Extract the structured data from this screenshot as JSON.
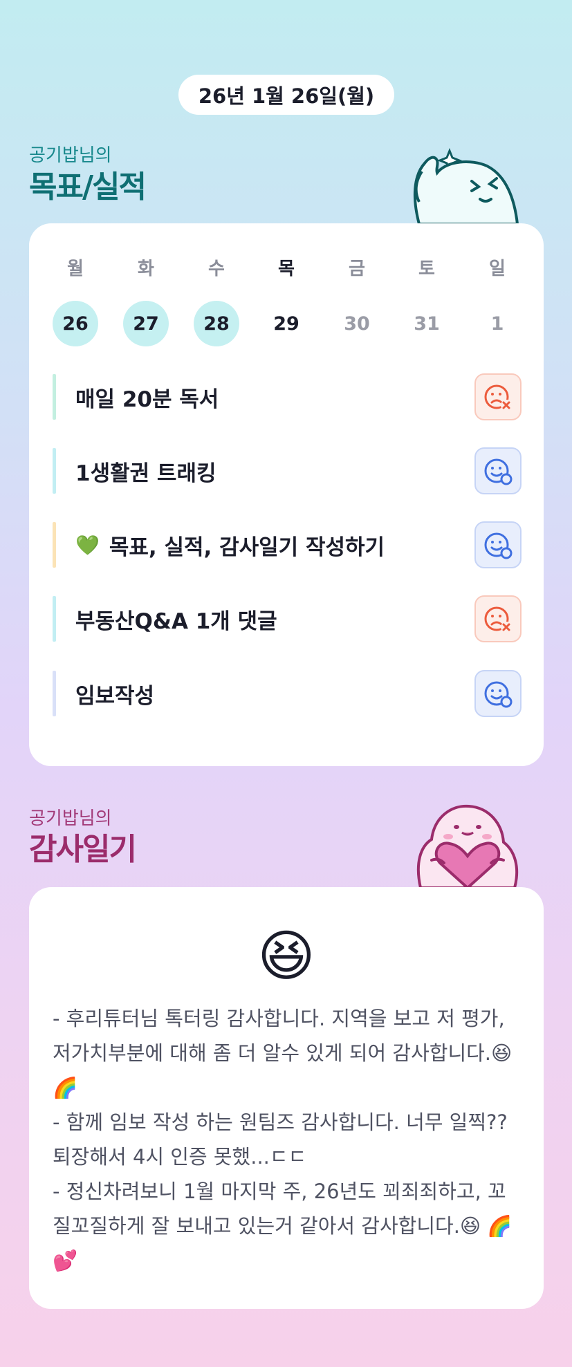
{
  "date": "26년 1월 26일(월)",
  "goals_section": {
    "subtitle": "공기밥님의",
    "title": "목표/실적"
  },
  "week": [
    {
      "day": "월",
      "date": "26",
      "state": "done"
    },
    {
      "day": "화",
      "date": "27",
      "state": "done"
    },
    {
      "day": "수",
      "date": "28",
      "state": "done"
    },
    {
      "day": "목",
      "date": "29",
      "state": "today"
    },
    {
      "day": "금",
      "date": "30",
      "state": "future"
    },
    {
      "day": "토",
      "date": "31",
      "state": "future"
    },
    {
      "day": "일",
      "date": "1",
      "state": "future"
    }
  ],
  "goals": [
    {
      "label": "매일 20분 독서",
      "status": "fail",
      "bar_color": "#c3efe0",
      "emoji": ""
    },
    {
      "label": "1생활권 트래킹",
      "status": "ok",
      "bar_color": "#c2eef3",
      "emoji": ""
    },
    {
      "label": "목표, 실적, 감사일기 작성하기",
      "status": "ok",
      "bar_color": "#fbe3b6",
      "emoji": "💚"
    },
    {
      "label": "부동산Q&A 1개 댓글",
      "status": "fail",
      "bar_color": "#c2eef3",
      "emoji": ""
    },
    {
      "label": "임보작성",
      "status": "ok",
      "bar_color": "#d9e0f8",
      "emoji": ""
    }
  ],
  "diary_section": {
    "subtitle": "공기밥님의",
    "title": "감사일기"
  },
  "diary": {
    "mood_emoji": "😆",
    "lines": [
      "- 후리튜터님 톡터링 감사합니다. 지역을 보고 저 평가, 저가치부분에 대해 좀 더 알수 있게 되어 감사합니다.😆 🌈",
      "- 함께 임보 작성 하는 원팀즈 감사합니다. 너무 일찍?? 퇴장해서 4시 인증 못했...ㄷㄷ",
      "- 정신차려보니 1월 마지막 주, 26년도 꾀죄죄하고, 꼬질꼬질하게 잘 보내고 있는거 같아서 감사합니다.😆 🌈 💕"
    ]
  },
  "colors": {
    "goals_title": "#0f6f73",
    "goals_subtitle": "#17888c",
    "diary_title": "#9b2c6b",
    "diary_subtitle": "#a23a78",
    "fail_icon": "#ec5b3c",
    "ok_icon": "#3f6fe0"
  },
  "icons": {
    "goals_character": "waving-ghost-character",
    "diary_character": "heart-hugging-ghost-character",
    "fail_status": "sad-face-x-icon",
    "ok_status": "smile-face-check-icon"
  }
}
